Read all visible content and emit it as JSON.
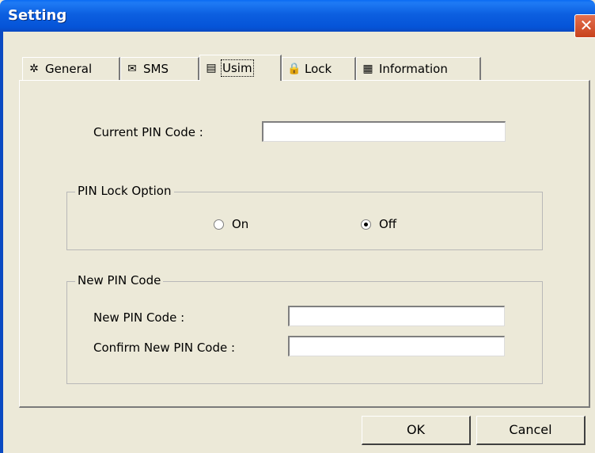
{
  "window": {
    "title": "Setting",
    "close_glyph": "✕"
  },
  "tabs": [
    {
      "icon": "gear-icon",
      "glyph": "✲",
      "label": "General"
    },
    {
      "icon": "envelope-icon",
      "glyph": "✉",
      "label": "SMS"
    },
    {
      "icon": "sim-card-icon",
      "glyph": "▤",
      "label": "Usim",
      "active": true
    },
    {
      "icon": "lock-icon",
      "glyph": "🔒",
      "label": "Lock"
    },
    {
      "icon": "document-icon",
      "glyph": "▦",
      "label": "Information"
    }
  ],
  "current_pin": {
    "label": "Current PIN Code :",
    "value": ""
  },
  "pin_lock": {
    "title": "PIN Lock Option",
    "options": [
      {
        "label": "On",
        "selected": false
      },
      {
        "label": "Off",
        "selected": true
      }
    ]
  },
  "new_pin": {
    "title": "New PIN Code",
    "new_label": "New PIN Code :",
    "new_value": "",
    "confirm_label": "Confirm New PIN Code :",
    "confirm_value": ""
  },
  "buttons": {
    "ok": "OK",
    "cancel": "Cancel"
  }
}
